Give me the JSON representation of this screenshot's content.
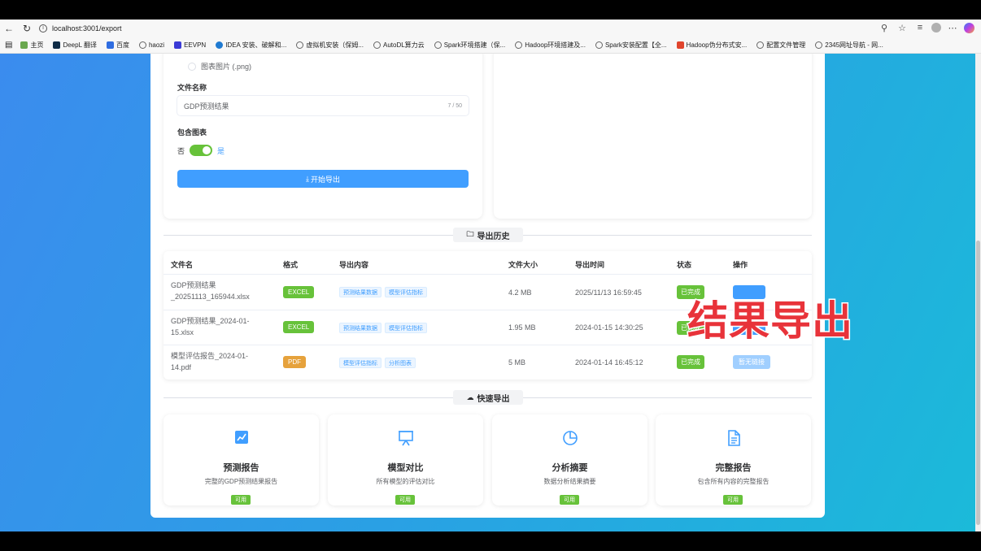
{
  "browser": {
    "url": "localhost:3001/export",
    "bookmarks": [
      "主页",
      "DeepL 翻译",
      "百度",
      "haozi",
      "EEVPN",
      "IDEA 安装、破解和...",
      "虚拟机安装（保姆...",
      "AutoDL算力云",
      "Spark环境搭建（保...",
      "Hadoop环境搭建及...",
      "Spark安装配置【全...",
      "Hadoop伪分布式安...",
      "配置文件管理",
      "2345网址导航 - 网..."
    ]
  },
  "export_form": {
    "format_option_png": "图表图片 (.png)",
    "filename_label": "文件名称",
    "filename_value": "GDP预测结果",
    "filename_count": "7 / 50",
    "include_charts_label": "包含图表",
    "switch_off_text": "否",
    "switch_on_text": "是",
    "start_button": "开始导出"
  },
  "history": {
    "title": "导出历史",
    "headers": [
      "文件名",
      "格式",
      "导出内容",
      "文件大小",
      "导出时间",
      "状态",
      "操作"
    ],
    "rows": [
      {
        "filename_l1": "GDP预测结果",
        "filename_l2": "_20251113_165944.xlsx",
        "format": "EXCEL",
        "contents": [
          "预测结果数据",
          "模型评估指标"
        ],
        "size": "4.2 MB",
        "time": "2025/11/13 16:59:45",
        "status": "已完成"
      },
      {
        "filename_l1": "GDP预测结果_2024-01-",
        "filename_l2": "15.xlsx",
        "format": "EXCEL",
        "contents": [
          "预测结果数据",
          "模型评估指标"
        ],
        "size": "1.95 MB",
        "time": "2024-01-15 14:30:25",
        "status": "已完成"
      },
      {
        "filename_l1": "模型评估报告_2024-01-",
        "filename_l2": "14.pdf",
        "format": "PDF",
        "contents": [
          "模型评估指标",
          "分析图表"
        ],
        "size": "5 MB",
        "time": "2024-01-14 16:45:12",
        "status": "已完成",
        "action": "暂无链接"
      }
    ]
  },
  "quick_export": {
    "title": "快速导出",
    "cards": [
      {
        "title": "预测报告",
        "desc": "完整的GDP预测结果报告",
        "badge": "可用"
      },
      {
        "title": "模型对比",
        "desc": "所有模型的评估对比",
        "badge": "可用"
      },
      {
        "title": "分析摘要",
        "desc": "数据分析结果摘要",
        "badge": "可用"
      },
      {
        "title": "完整报告",
        "desc": "包含所有内容的完整报告",
        "badge": "可用"
      }
    ]
  },
  "overlay_caption": "结果导出",
  "colors": {
    "primary": "#409eff",
    "success": "#67c23a",
    "warning": "#e6a23c",
    "overlay": "#e8333a"
  }
}
